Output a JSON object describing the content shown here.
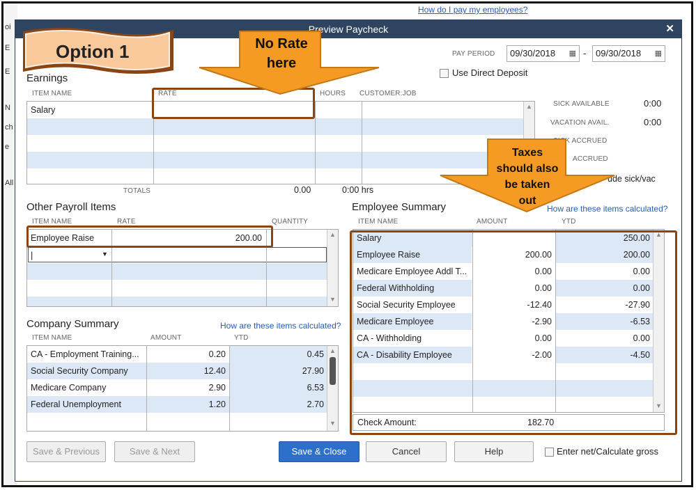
{
  "background": {
    "top_link": "How do I pay my employees?"
  },
  "dialog": {
    "title": "Preview Paycheck",
    "pay_period_label": "PAY PERIOD",
    "pay_period_start": "09/30/2018",
    "pay_period_end": "09/30/2018",
    "pay_period_sep": "-",
    "direct_deposit_label": "Use Direct Deposit"
  },
  "annotations": {
    "option_label": "Option 1",
    "no_rate_line1": "No Rate",
    "no_rate_line2": "here",
    "taxes_line1": "Taxes",
    "taxes_line2": "should also",
    "taxes_line3": "be taken",
    "taxes_line4": "out"
  },
  "earnings": {
    "title": "Earnings",
    "headers": {
      "item": "ITEM NAME",
      "rate": "RATE",
      "hours": "HOURS",
      "customer": "CUSTOMER:JOB"
    },
    "rows": [
      {
        "item": "Salary",
        "rate": "",
        "hours": "",
        "customer": ""
      }
    ],
    "totals_label": "TOTALS",
    "total_rate": "0.00",
    "total_hours": "0:00 hrs"
  },
  "sick": {
    "sick_available_label": "SICK AVAILABLE",
    "sick_available_value": "0:00",
    "vacation_avail_label": "VACATION AVAIL.",
    "vacation_avail_value": "0:00",
    "sick_accrued_label": "SICK ACCRUED",
    "vac_accrued_label": "ACCRUED",
    "sick_vac_label": "ude sick/vac"
  },
  "other_items": {
    "title": "Other Payroll Items",
    "headers": {
      "item": "ITEM NAME",
      "rate": "RATE",
      "quantity": "QUANTITY"
    },
    "rows": [
      {
        "item": "Employee Raise",
        "rate": "200.00",
        "quantity": ""
      }
    ]
  },
  "employee_summary": {
    "title": "Employee Summary",
    "help_link": "How are these items calculated?",
    "headers": {
      "item": "ITEM NAME",
      "amount": "AMOUNT",
      "ytd": "YTD"
    },
    "rows": [
      {
        "item": "Salary",
        "amount": "",
        "ytd": "250.00"
      },
      {
        "item": "Employee Raise",
        "amount": "200.00",
        "ytd": "200.00"
      },
      {
        "item": "Medicare Employee Addl T...",
        "amount": "0.00",
        "ytd": "0.00"
      },
      {
        "item": "Federal Withholding",
        "amount": "0.00",
        "ytd": "0.00"
      },
      {
        "item": "Social Security Employee",
        "amount": "-12.40",
        "ytd": "-27.90"
      },
      {
        "item": "Medicare Employee",
        "amount": "-2.90",
        "ytd": "-6.53"
      },
      {
        "item": "CA - Withholding",
        "amount": "0.00",
        "ytd": "0.00"
      },
      {
        "item": "CA - Disability Employee",
        "amount": "-2.00",
        "ytd": "-4.50"
      }
    ],
    "check_amount_label": "Check Amount:",
    "check_amount_value": "182.70"
  },
  "company_summary": {
    "title": "Company Summary",
    "help_link": "How are these items calculated?",
    "headers": {
      "item": "ITEM NAME",
      "amount": "AMOUNT",
      "ytd": "YTD"
    },
    "rows": [
      {
        "item": "CA - Employment Training...",
        "amount": "0.20",
        "ytd": "0.45"
      },
      {
        "item": "Social Security Company",
        "amount": "12.40",
        "ytd": "27.90"
      },
      {
        "item": "Medicare Company",
        "amount": "2.90",
        "ytd": "6.53"
      },
      {
        "item": "Federal Unemployment",
        "amount": "1.20",
        "ytd": "2.70"
      }
    ]
  },
  "buttons": {
    "save_previous": "Save & Previous",
    "save_next": "Save & Next",
    "save_close": "Save & Close",
    "cancel": "Cancel",
    "help": "Help",
    "net_gross": "Enter net/Calculate gross"
  },
  "colors": {
    "title_bar": "#2f4461",
    "row_alt": "#dde8f6",
    "annotation_orange": "#f59a23",
    "annotation_border": "#8b4513",
    "primary_button": "#2e6fcc"
  }
}
